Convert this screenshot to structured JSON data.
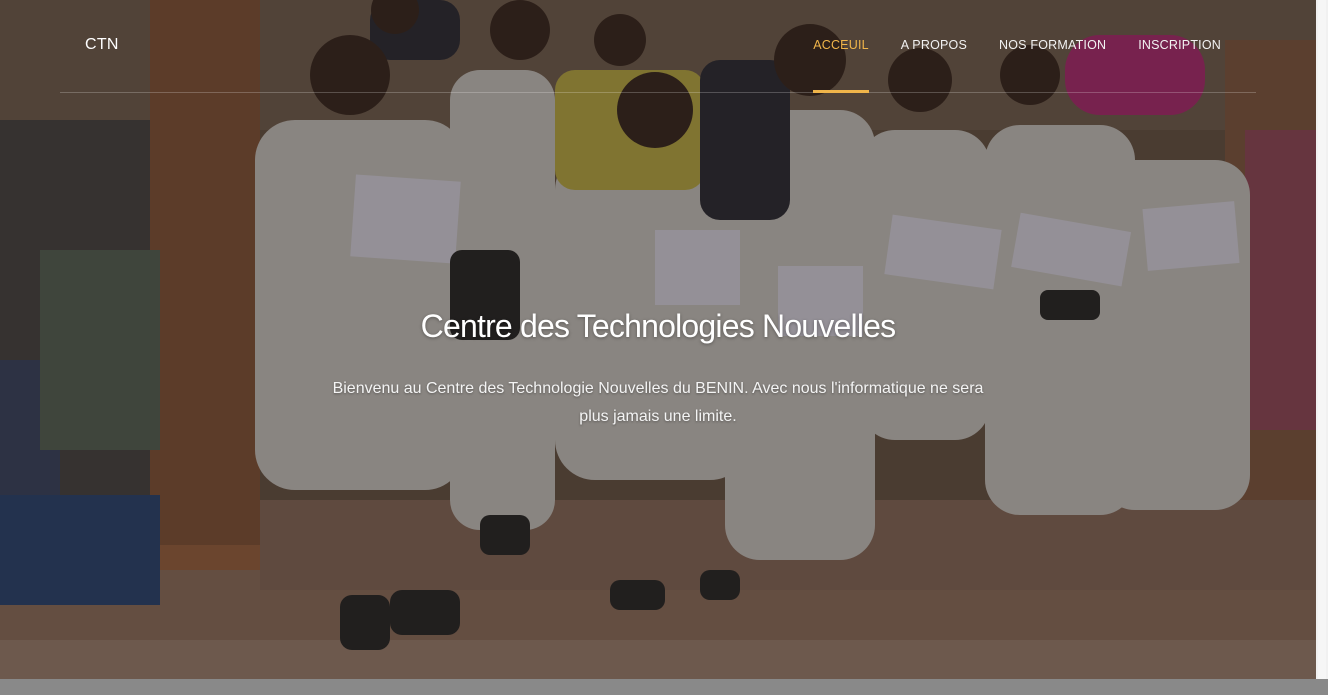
{
  "navbar": {
    "brand": "CTN",
    "items": [
      {
        "label": "ACCEUIL",
        "active": true
      },
      {
        "label": "A PROPOS",
        "active": false
      },
      {
        "label": "NOS FORMATION",
        "active": false
      },
      {
        "label": "INSCRIPTION",
        "active": false
      }
    ]
  },
  "hero": {
    "title": "Centre des Technologies Nouvelles",
    "subtitle": "Bienvenu au Centre des Technologie Nouvelles du BENIN. Avec nous l'informatique ne sera plus jamais une limite."
  },
  "colors": {
    "accent": "#f0b54a",
    "text": "#ffffff",
    "overlay": "rgba(20,16,12,0.40)"
  }
}
